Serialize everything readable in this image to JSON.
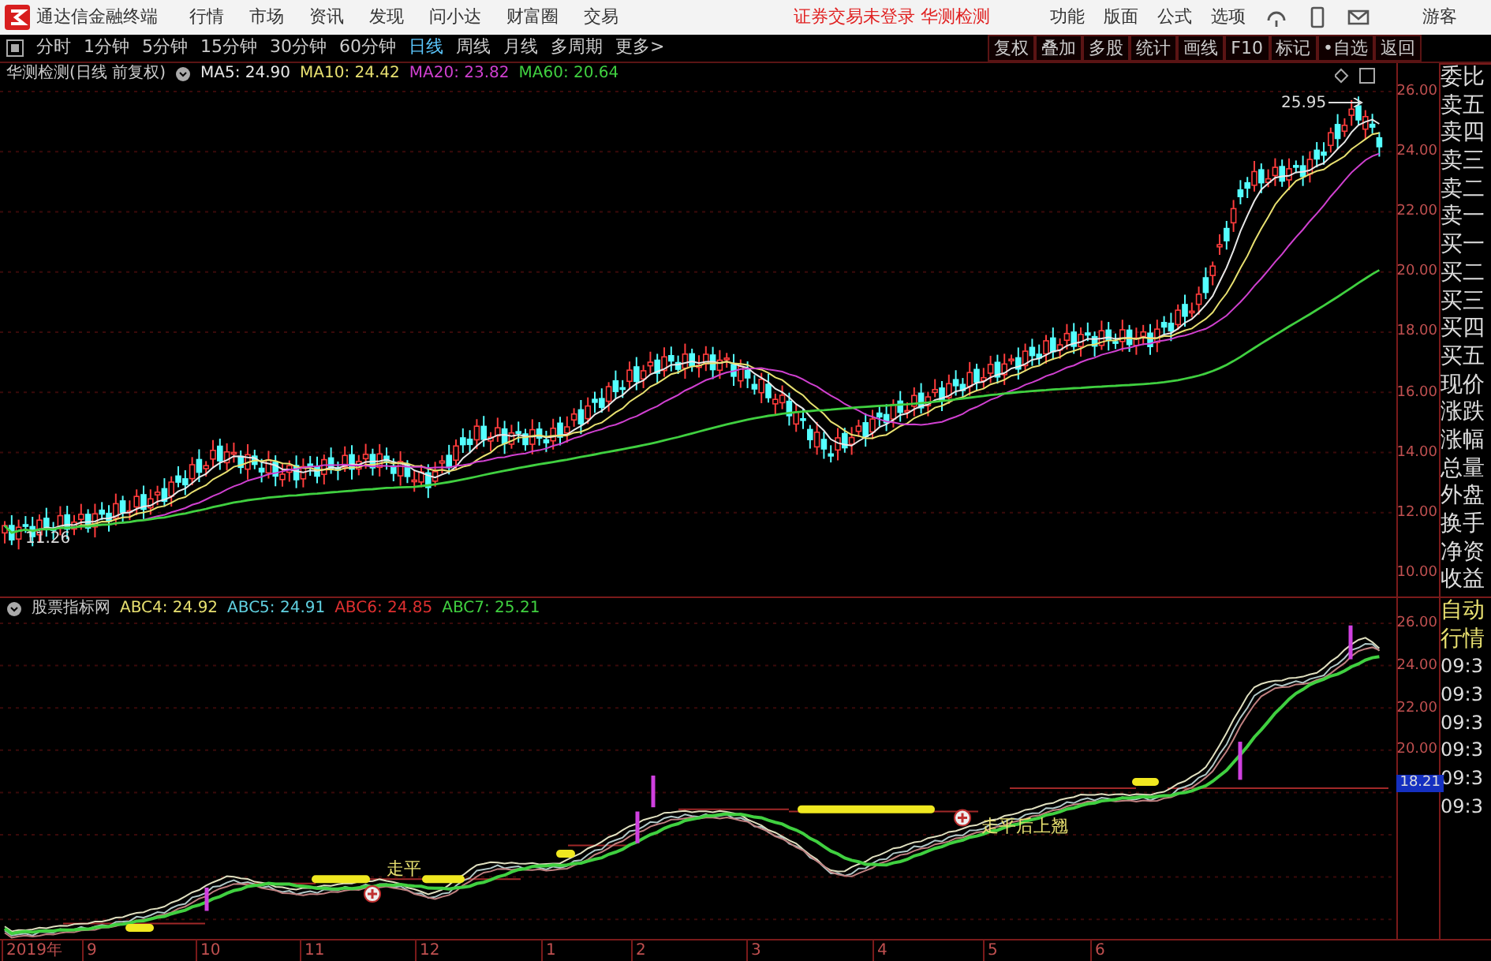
{
  "app": {
    "title": "通达信金融终端",
    "menu": [
      "行情",
      "市场",
      "资讯",
      "发现",
      "问小达",
      "财富圈",
      "交易"
    ],
    "status": "证券交易未登录 华测检测",
    "tools": [
      "功能",
      "版面",
      "公式",
      "选项"
    ],
    "user": "游客"
  },
  "periods": [
    {
      "label": "分时",
      "selected": false
    },
    {
      "label": "1分钟",
      "selected": false
    },
    {
      "label": "5分钟",
      "selected": false
    },
    {
      "label": "15分钟",
      "selected": false
    },
    {
      "label": "30分钟",
      "selected": false
    },
    {
      "label": "60分钟",
      "selected": false
    },
    {
      "label": "日线",
      "selected": true
    },
    {
      "label": "周线",
      "selected": false
    },
    {
      "label": "月线",
      "selected": false
    },
    {
      "label": "多周期",
      "selected": false
    },
    {
      "label": "更多>",
      "selected": false
    }
  ],
  "actions": [
    "复权",
    "叠加",
    "多股",
    "统计",
    "画线",
    "F10",
    "标记",
    "•自选",
    "返回"
  ],
  "main_chart": {
    "title": "华测检测(日线 前复权)",
    "indicators": [
      {
        "label": "MA5: 24.90",
        "color": "#e8e8e8"
      },
      {
        "label": "MA10: 24.42",
        "color": "#e8e070"
      },
      {
        "label": "MA20: 23.82",
        "color": "#d040d0"
      },
      {
        "label": "MA60: 20.64",
        "color": "#40d040"
      }
    ],
    "high_label": "25.95",
    "low_label": "11.26",
    "price_axis": [
      "26.00",
      "24.00",
      "22.00",
      "20.00",
      "18.00",
      "16.00",
      "14.00",
      "12.00",
      "10.00"
    ]
  },
  "quote_panel": [
    "委比",
    "卖五",
    "卖四",
    "卖三",
    "卖二",
    "卖一",
    "买一",
    "买二",
    "买三",
    "买四",
    "买五",
    "现价",
    "涨跌",
    "涨幅",
    "总量",
    "外盘",
    "换手",
    "净资",
    "收益"
  ],
  "indicator_chart": {
    "title": "股票指标网",
    "indicators": [
      {
        "label": "ABC4: 24.92",
        "color": "#e8e070"
      },
      {
        "label": "ABC5: 24.91",
        "color": "#60d0e0"
      },
      {
        "label": "ABC6: 24.85",
        "color": "#e03030"
      },
      {
        "label": "ABC7: 25.21",
        "color": "#40d040"
      }
    ],
    "annotations": [
      "走平",
      "走平后上翘"
    ],
    "axis": [
      "26.00",
      "24.00",
      "22.00",
      "20.00"
    ],
    "current_value": "18.21"
  },
  "side_panel": [
    "自动",
    "行情",
    "09:3",
    "09:3",
    "09:3",
    "09:3",
    "09:3",
    "09:3"
  ],
  "time_axis": [
    "2019年",
    "9",
    "10",
    "11",
    "12",
    "1",
    "2",
    "3",
    "4",
    "5",
    "6"
  ]
}
